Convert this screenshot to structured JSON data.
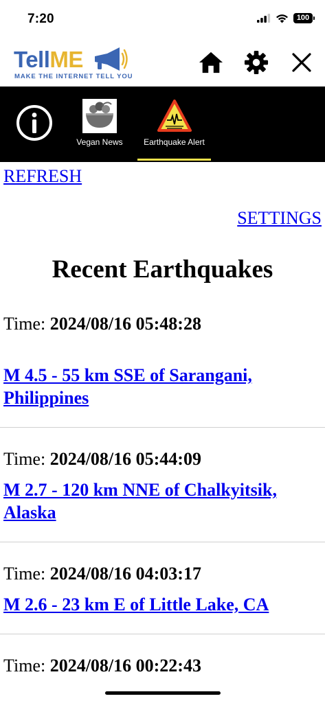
{
  "status_bar": {
    "time": "7:20",
    "battery": "100"
  },
  "header": {
    "logo": {
      "tell": "Tell",
      "me": "ME",
      "tagline": "MAKE THE INTERNET TELL YOU"
    },
    "actions": [
      {
        "icon": "home-icon"
      },
      {
        "icon": "gear-icon"
      },
      {
        "icon": "close-icon"
      }
    ]
  },
  "tabs": [
    {
      "icon": "info-icon",
      "label": ""
    },
    {
      "icon": "vegan-bowl-icon",
      "label": "Vegan News"
    },
    {
      "icon": "earthquake-alert-icon",
      "label": "Earthquake Alert",
      "selected": true
    }
  ],
  "colors": {
    "brand_blue": "#3b66b3",
    "brand_yellow": "#e7b530",
    "tab_bar_bg": "#000000",
    "tab_underline": "#f3e24b",
    "link": "#0000ee"
  },
  "content": {
    "refresh_label": "REFRESH",
    "settings_label": "SETTINGS",
    "title": "Recent Earthquakes",
    "time_prefix": "Time:",
    "quakes": [
      {
        "time": "2024/08/16 05:48:28",
        "title": "M 4.5 - 55 km SSE of Sarangani, Philippines"
      },
      {
        "time": "2024/08/16 05:44:09",
        "title": "M 2.7 - 120 km NNE of Chalkyitsik, Alaska"
      },
      {
        "time": "2024/08/16 04:03:17",
        "title": "M 2.6 - 23 km E of Little Lake, CA"
      },
      {
        "time": "2024/08/16 00:22:43",
        "title": ""
      }
    ]
  }
}
